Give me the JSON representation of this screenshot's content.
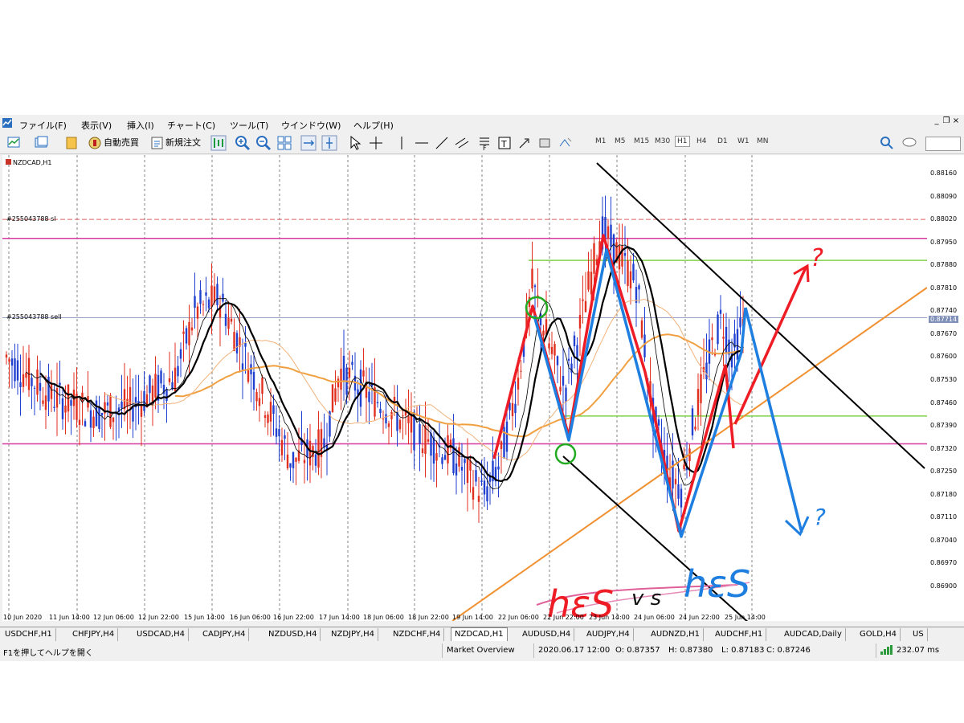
{
  "menu": {
    "items": [
      "ファイル(F)",
      "表示(V)",
      "挿入(I)",
      "チャート(C)",
      "ツール(T)",
      "ウインドウ(W)",
      "ヘルプ(H)"
    ]
  },
  "toolbar": {
    "auto_trade_label": "自動売買",
    "new_order_label": "新規注文",
    "timeframes": [
      "M1",
      "M5",
      "M15",
      "M30",
      "H1",
      "H4",
      "D1",
      "W1",
      "MN"
    ],
    "selected_timeframe": "H1"
  },
  "chart": {
    "symbol_label": "NZDCAD,H1",
    "sl_label": "#255043788 sl",
    "sell_label": "#255043788 sell",
    "current_price": "0.87714",
    "price_labels": [
      "0.88160",
      "0.88090",
      "0.88020",
      "0.87950",
      "0.87880",
      "0.87810",
      "0.87740",
      "0.87670",
      "0.87600",
      "0.87530",
      "0.87460",
      "0.87390",
      "0.87320",
      "0.87250",
      "0.87180",
      "0.87110",
      "0.87040",
      "0.86970",
      "0.86900"
    ],
    "time_labels": [
      "10 Jun 2020",
      "11 Jun 14:00",
      "12 Jun 06:00",
      "12 Jun 22:00",
      "15 Jun 14:00",
      "16 Jun 06:00",
      "16 Jun 22:00",
      "17 Jun 14:00",
      "18 Jun 06:00",
      "18 Jun 22:00",
      "19 Jun 14:00",
      "22 Jun 06:00",
      "22 Jun 22:00",
      "23 Jun 14:00",
      "24 Jun 06:00",
      "24 Jun 22:00",
      "25 Jun 14:00"
    ],
    "handwriting": {
      "left_text": "hεS",
      "vs_text": "v s",
      "right_text": "hεS",
      "q1": "?",
      "q2": "?"
    },
    "colors": {
      "bull": "#e03020",
      "bear": "#2040d0",
      "magenta_line": "#d63a9c",
      "green_line": "#7fd24a",
      "orange_ma": "#f0a040",
      "black_trendline": "#000000",
      "pen_red": "#ee1c24",
      "pen_blue": "#1e7fe0",
      "pen_green": "#22aa22"
    }
  },
  "tabs": [
    "USDCHF,H1",
    "CHFJPY,H4",
    "USDCAD,H4",
    "CADJPY,H4",
    "NZDUSD,H4",
    "NZDJPY,H4",
    "NZDCHF,H4",
    "NZDCAD,H1",
    "AUDUSD,H4",
    "AUDJPY,H4",
    "AUDNZD,H1",
    "AUDCHF,H1",
    "AUDCAD,Daily",
    "GOLD,H4",
    "US"
  ],
  "active_tab": "NZDCAD,H1",
  "status": {
    "help_text": "F1を押してヘルプを開く",
    "profile": "Market Overview",
    "datetime": "2020.06.17 12:00",
    "open": "O: 0.87357",
    "high": "H: 0.87380",
    "low": "L: 0.87183",
    "close": "C: 0.87246",
    "ping": "232.07 ms"
  }
}
